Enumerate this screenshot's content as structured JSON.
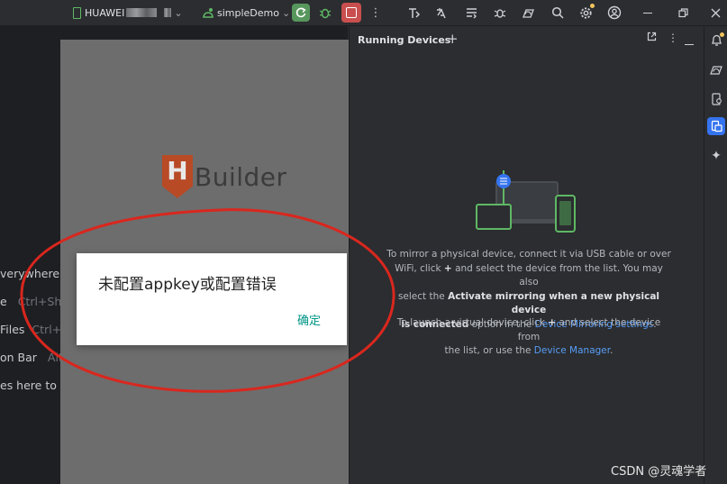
{
  "toolbar": {
    "device_name": "HUAWEI",
    "run_config": "simpleDemo",
    "device_chevron": "⌄",
    "config_chevron": "⌄"
  },
  "editor": {
    "hints": [
      {
        "label": "verywhere",
        "shortcut": ""
      },
      {
        "label": "e",
        "shortcut": "Ctrl+Shi"
      },
      {
        "label": "Files",
        "shortcut": "Ctrl+E"
      },
      {
        "label": "on Bar",
        "shortcut": "Alt"
      },
      {
        "label": "es here to o",
        "shortcut": ""
      }
    ]
  },
  "emulator": {
    "logo_letter": "H",
    "logo_text": "Builder",
    "dialog": {
      "message": "未配置appkey或配置错误",
      "ok_label": "确定"
    }
  },
  "panel": {
    "title": "Running Devices",
    "plus": "+",
    "mirror": {
      "line1": "To mirror a physical device, connect it via USB cable or over",
      "line2a": "WiFi, click",
      "line2b": "and select the device from the list. You may also",
      "line3a": "select the",
      "line3b": "Activate mirroring when a new physical device",
      "line4a": "is connected",
      "line4b": "option in the",
      "link": "Device Mirroring settings",
      "line4c": "."
    },
    "virtual": {
      "line1a": "To launch a virtual device, click",
      "line1b": "and select the device from",
      "line2a": "the list, or use the",
      "link": "Device Manager",
      "line2b": "."
    },
    "plus_glyph": "+"
  },
  "watermark": "CSDN @灵魂学者",
  "colors": {
    "accent": "#3574f0",
    "run": "#57965c",
    "stop": "#c94f4f",
    "link": "#589df6",
    "dialog_ok": "#009688",
    "annotation": "#d9271e"
  }
}
